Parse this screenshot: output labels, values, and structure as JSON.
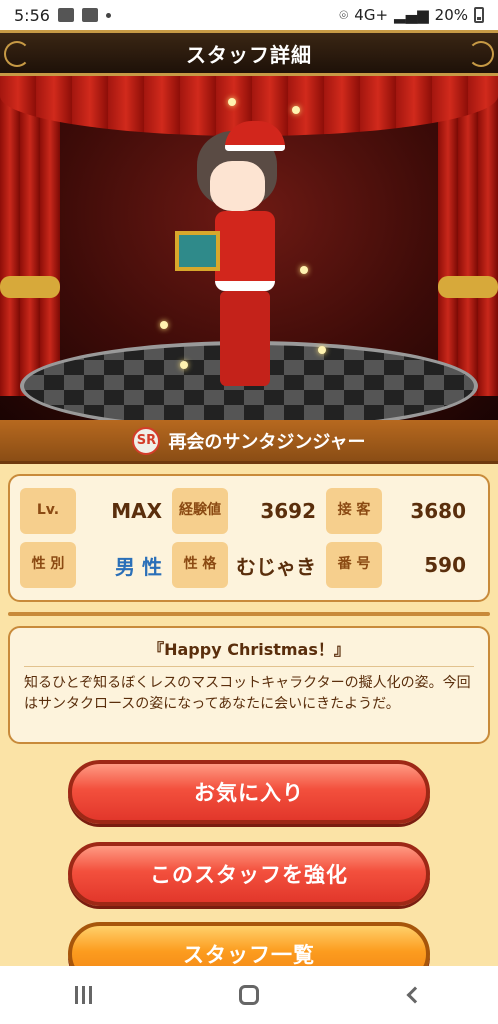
{
  "status_bar": {
    "time": "5:56",
    "network": "4G+",
    "battery": "20%"
  },
  "header": {
    "title": "スタッフ詳細"
  },
  "staff": {
    "rarity": "SR",
    "name": "再会のサンタジンジャー"
  },
  "stats": {
    "row1": [
      {
        "label": "Lv.",
        "value": "MAX"
      },
      {
        "label": "経験値",
        "value": "3692"
      },
      {
        "label": "接 客",
        "value": "3680"
      }
    ],
    "row2": [
      {
        "label": "性 別",
        "value": "男 性"
      },
      {
        "label": "性 格",
        "value": "むじゃき"
      },
      {
        "label": "番 号",
        "value": "590"
      }
    ]
  },
  "description": {
    "title": "『Happy Christmas！』",
    "text": "知るひとぞ知るぼくレスのマスコットキャラクターの擬人化の姿。今回はサンタクロースの姿になってあなたに会いにきたようだ。"
  },
  "buttons": {
    "favorite": "お気に入り",
    "enhance": "このスタッフを強化",
    "staff_list": "スタッフ一覧"
  },
  "colors": {
    "accent_red": "#e2372b",
    "accent_orange": "#f18313",
    "panel_border": "#c88a3a",
    "title_bar": "#1e1108"
  }
}
